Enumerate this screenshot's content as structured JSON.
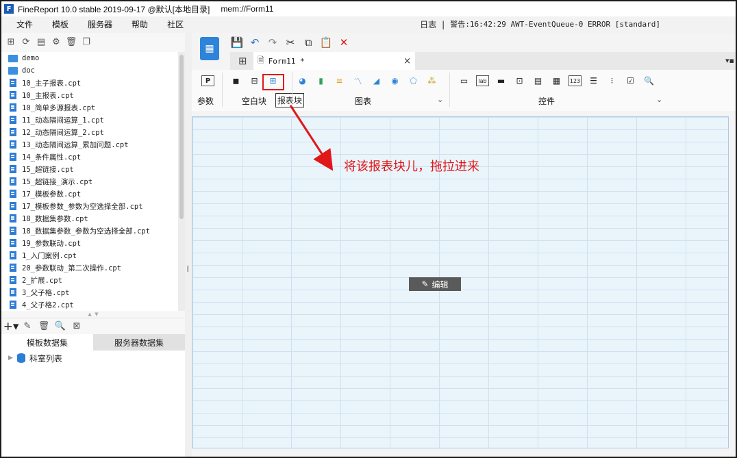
{
  "window": {
    "title": "FineReport 10.0 stable 2019-09-17 @默认[本地目录]",
    "path": "mem://Form11"
  },
  "menu": [
    "文件",
    "模板",
    "服务器",
    "帮助",
    "社区"
  ],
  "status": {
    "log": "日志",
    "sep": "|",
    "warning": "警告:16:42:29 AWT-EventQueue-0 ERROR [standard]"
  },
  "tree": {
    "items": [
      {
        "type": "folder",
        "label": "demo"
      },
      {
        "type": "folder",
        "label": "doc"
      },
      {
        "type": "file",
        "label": "10_主子报表.cpt"
      },
      {
        "type": "file",
        "label": "10_主报表.cpt"
      },
      {
        "type": "file",
        "label": "10_简单多源报表.cpt"
      },
      {
        "type": "file",
        "label": "11_动态隔间运算_1.cpt"
      },
      {
        "type": "file",
        "label": "12_动态隔间运算_2.cpt"
      },
      {
        "type": "file",
        "label": "13_动态隔间运算_累加问题.cpt"
      },
      {
        "type": "file",
        "label": "14_条件属性.cpt"
      },
      {
        "type": "file",
        "label": "15_超链接.cpt"
      },
      {
        "type": "file",
        "label": "15_超链接_演示.cpt"
      },
      {
        "type": "file",
        "label": "17_模板参数.cpt"
      },
      {
        "type": "file",
        "label": "17_模板参数_参数为空选择全部.cpt"
      },
      {
        "type": "file",
        "label": "18_数据集参数.cpt"
      },
      {
        "type": "file",
        "label": "18_数据集参数_参数为空选择全部.cpt"
      },
      {
        "type": "file",
        "label": "19_参数联动.cpt"
      },
      {
        "type": "file",
        "label": "1_入门案例.cpt"
      },
      {
        "type": "file",
        "label": "20_参数联动_第二次操作.cpt"
      },
      {
        "type": "file",
        "label": "2_扩展.cpt"
      },
      {
        "type": "file",
        "label": "3_父子格.cpt"
      },
      {
        "type": "file",
        "label": "4_父子格2.cpt"
      }
    ]
  },
  "datasets": {
    "tabs": [
      "模板数据集",
      "服务器数据集"
    ],
    "items": [
      "科室列表"
    ]
  },
  "editor": {
    "tab_title": "Form11 *",
    "close": "×",
    "groups": {
      "param": "参数",
      "blank_block": "空白块",
      "chart": "图表",
      "widget": "控件"
    },
    "tooltip": "报表块",
    "edit_button": "编辑"
  },
  "annotation": {
    "text": "将该报表块儿，拖拉进来",
    "color": "#e01818"
  },
  "colors": {
    "accent": "#2d84d9",
    "canvas": "#eaf4fb",
    "highlight": "#e01818"
  }
}
